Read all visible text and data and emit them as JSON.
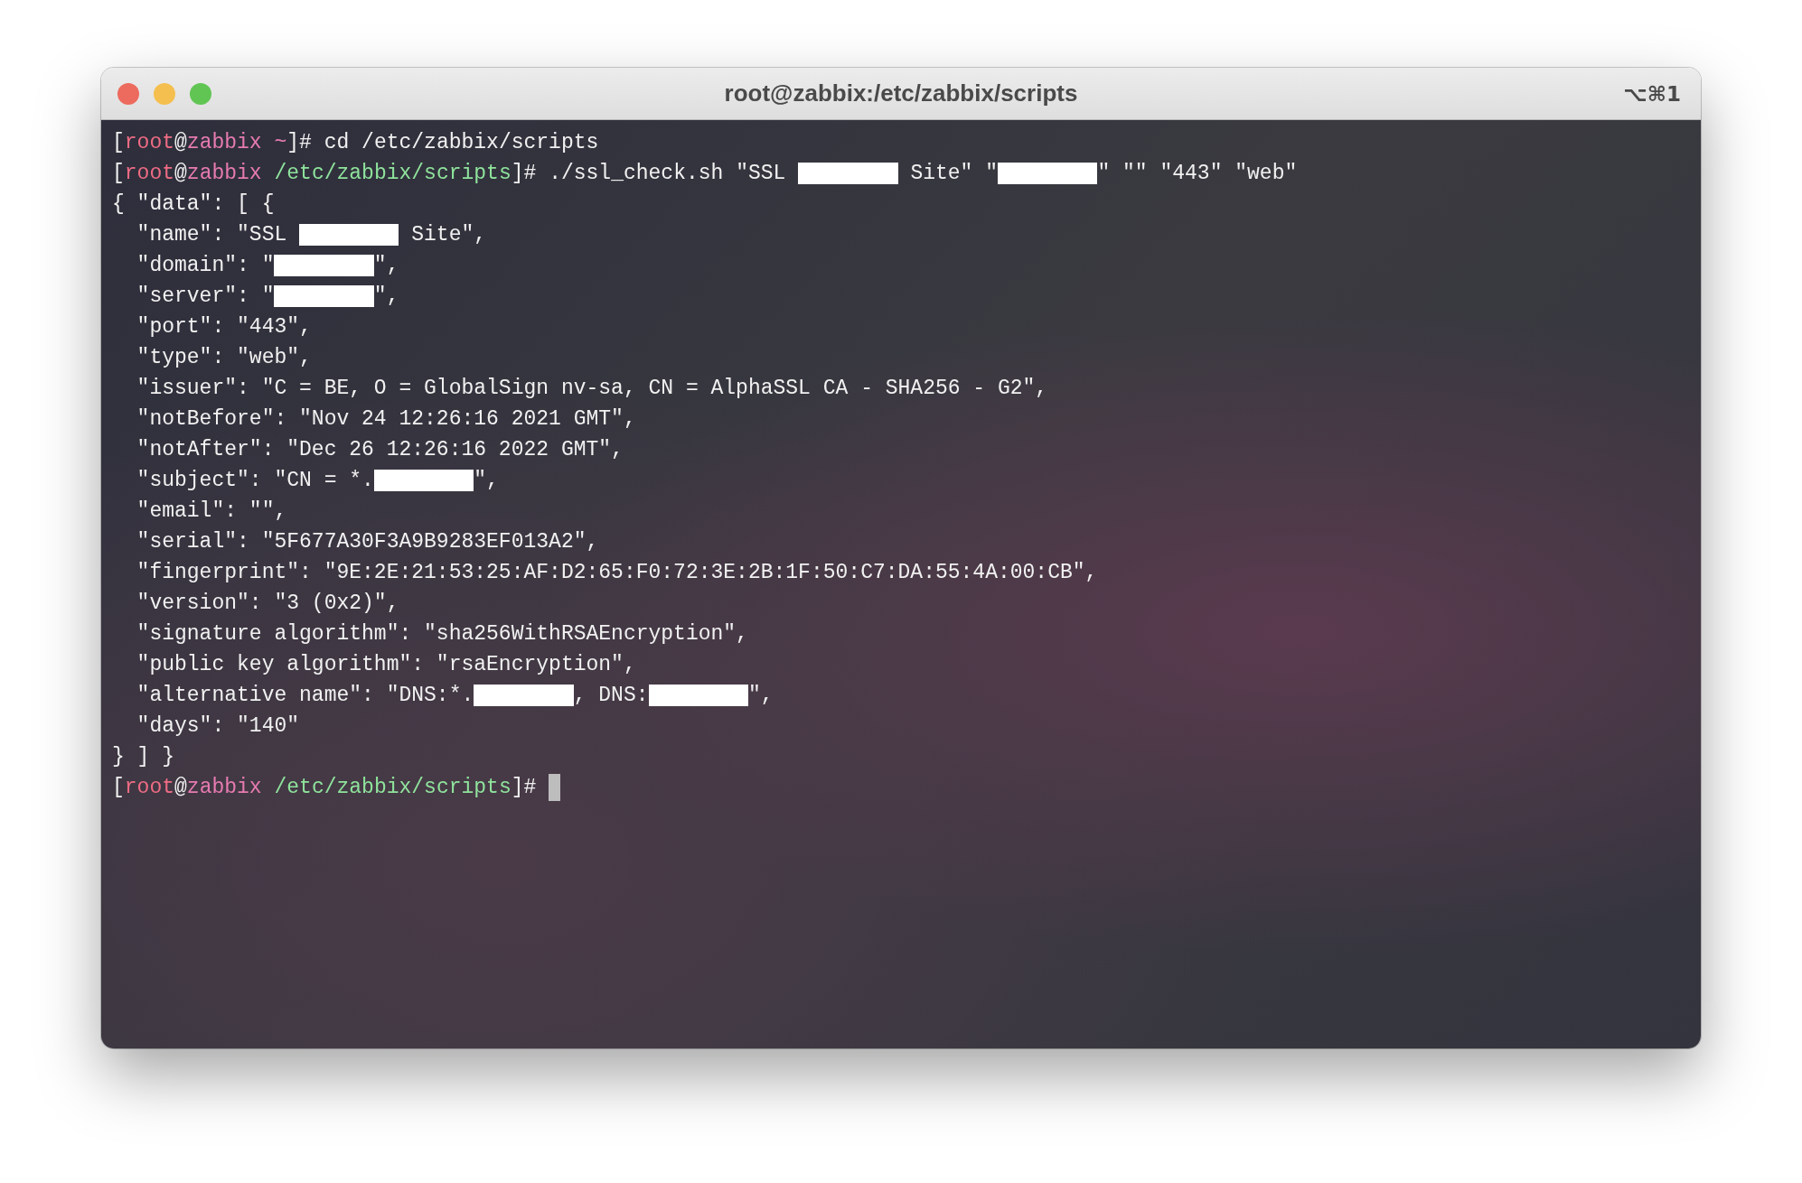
{
  "window": {
    "title": "root@zabbix:/etc/zabbix/scripts",
    "shortcut": "⌥⌘1"
  },
  "terminal": {
    "lines": [
      [
        {
          "text": "[",
          "kind": "plain"
        },
        {
          "text": "root",
          "kind": "user"
        },
        {
          "text": "@",
          "kind": "plain"
        },
        {
          "text": "zabbix ~",
          "kind": "host"
        },
        {
          "text": "]# cd /etc/zabbix/scripts",
          "kind": "plain"
        }
      ],
      [
        {
          "text": "[",
          "kind": "plain"
        },
        {
          "text": "root",
          "kind": "user"
        },
        {
          "text": "@",
          "kind": "plain"
        },
        {
          "text": "zabbix ",
          "kind": "host"
        },
        {
          "text": "/etc/zabbix/scripts",
          "kind": "path"
        },
        {
          "text": "]# ./ssl_check.sh \"SSL ",
          "kind": "plain"
        },
        {
          "kind": "redacted"
        },
        {
          "text": " Site\" \"",
          "kind": "plain"
        },
        {
          "kind": "redacted"
        },
        {
          "text": "\" \"\" \"443\" \"web\"",
          "kind": "plain"
        }
      ],
      [
        {
          "text": "{ \"data\": [ {",
          "kind": "plain"
        }
      ],
      [
        {
          "text": "  \"name\": \"SSL ",
          "kind": "plain"
        },
        {
          "kind": "redacted"
        },
        {
          "text": " Site\",",
          "kind": "plain"
        }
      ],
      [
        {
          "text": "  \"domain\": \"",
          "kind": "plain"
        },
        {
          "kind": "redacted"
        },
        {
          "text": "\",",
          "kind": "plain"
        }
      ],
      [
        {
          "text": "  \"server\": \"",
          "kind": "plain"
        },
        {
          "kind": "redacted"
        },
        {
          "text": "\",",
          "kind": "plain"
        }
      ],
      [
        {
          "text": "  \"port\": \"443\",",
          "kind": "plain"
        }
      ],
      [
        {
          "text": "  \"type\": \"web\",",
          "kind": "plain"
        }
      ],
      [
        {
          "text": "  \"issuer\": \"C = BE, O = GlobalSign nv-sa, CN = AlphaSSL CA - SHA256 - G2\",",
          "kind": "plain"
        }
      ],
      [
        {
          "text": "  \"notBefore\": \"Nov 24 12:26:16 2021 GMT\",",
          "kind": "plain"
        }
      ],
      [
        {
          "text": "  \"notAfter\": \"Dec 26 12:26:16 2022 GMT\",",
          "kind": "plain"
        }
      ],
      [
        {
          "text": "  \"subject\": \"CN = *.",
          "kind": "plain"
        },
        {
          "kind": "redacted"
        },
        {
          "text": "\",",
          "kind": "plain"
        }
      ],
      [
        {
          "text": "  \"email\": \"\",",
          "kind": "plain"
        }
      ],
      [
        {
          "text": "  \"serial\": \"5F677A30F3A9B9283EF013A2\",",
          "kind": "plain"
        }
      ],
      [
        {
          "text": "  \"fingerprint\": \"9E:2E:21:53:25:AF:D2:65:F0:72:3E:2B:1F:50:C7:DA:55:4A:00:CB\",",
          "kind": "plain"
        }
      ],
      [
        {
          "text": "  \"version\": \"3 (0x2)\",",
          "kind": "plain"
        }
      ],
      [
        {
          "text": "  \"signature algorithm\": \"sha256WithRSAEncryption\",",
          "kind": "plain"
        }
      ],
      [
        {
          "text": "  \"public key algorithm\": \"rsaEncryption\",",
          "kind": "plain"
        }
      ],
      [
        {
          "text": "  \"alternative name\": \"DNS:*.",
          "kind": "plain"
        },
        {
          "kind": "redacted"
        },
        {
          "text": ", DNS:",
          "kind": "plain"
        },
        {
          "kind": "redacted"
        },
        {
          "text": "\",",
          "kind": "plain"
        }
      ],
      [
        {
          "text": "  \"days\": \"140\"",
          "kind": "plain"
        }
      ],
      [
        {
          "text": "} ] }",
          "kind": "plain"
        }
      ],
      [
        {
          "text": "[",
          "kind": "plain"
        },
        {
          "text": "root",
          "kind": "user"
        },
        {
          "text": "@",
          "kind": "plain"
        },
        {
          "text": "zabbix ",
          "kind": "host"
        },
        {
          "text": "/etc/zabbix/scripts",
          "kind": "path"
        },
        {
          "text": "]# ",
          "kind": "plain"
        },
        {
          "kind": "cursor"
        }
      ]
    ]
  }
}
